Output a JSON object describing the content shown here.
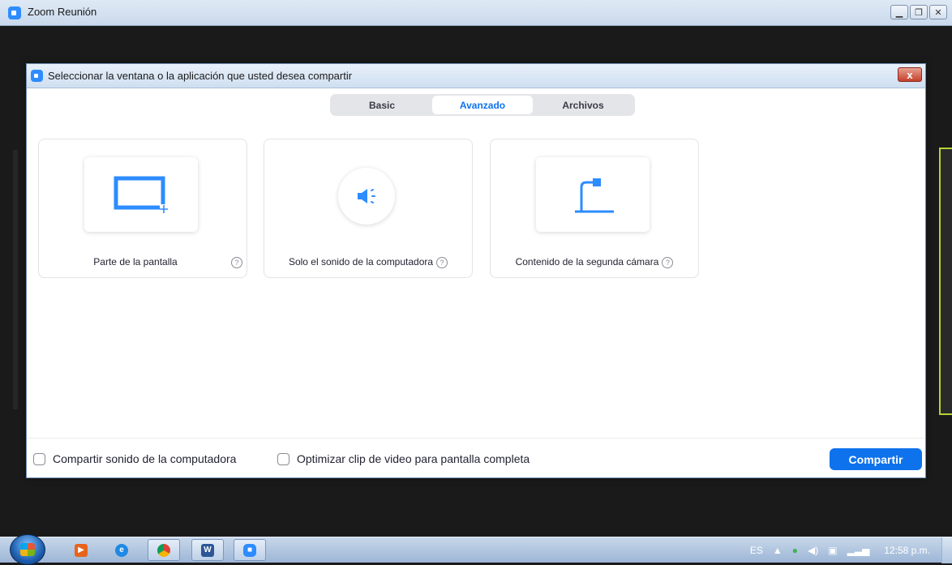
{
  "window": {
    "title": "Zoom Reunión",
    "controls": [
      "minimize-icon",
      "restore-icon",
      "close-icon"
    ]
  },
  "dialog": {
    "title": "Seleccionar la ventana o la aplicación que usted desea compartir",
    "close_label": "x",
    "tabs": [
      {
        "label": "Basic",
        "active": false
      },
      {
        "label": "Avanzado",
        "active": true
      },
      {
        "label": "Archivos",
        "active": false
      }
    ],
    "options": [
      {
        "label": "Parte de la pantalla",
        "icon": "screen-portion-icon"
      },
      {
        "label": "Solo el sonido de la computadora",
        "icon": "speaker-icon"
      },
      {
        "label": "Contenido de la segunda cámara",
        "icon": "document-camera-icon"
      }
    ],
    "help_glyph": "?",
    "footer": {
      "share_sound_label": "Compartir sonido de la computadora",
      "optimize_video_label": "Optimizar clip de video para pantalla completa",
      "share_button": "Compartir"
    }
  },
  "taskbar": {
    "apps": [
      "media-player-icon",
      "internet-explorer-icon",
      "chrome-icon",
      "word-icon",
      "zoom-icon"
    ],
    "tray": {
      "language": "ES",
      "clock": "12:58 p.m."
    }
  },
  "colors": {
    "accent": "#0e72ed",
    "zoom_brand": "#2d8cff",
    "icon_blue": "#2d8cff"
  }
}
